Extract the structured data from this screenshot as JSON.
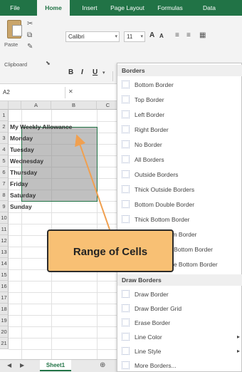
{
  "ribbon": {
    "tabs": [
      {
        "label": "File",
        "active": false
      },
      {
        "label": "Home",
        "active": true
      },
      {
        "label": "Insert",
        "active": false
      },
      {
        "label": "Page Layout",
        "active": false
      },
      {
        "label": "Formulas",
        "active": false
      },
      {
        "label": "Data",
        "active": false
      }
    ],
    "paste_label": "Paste",
    "clipboard_label": "Clipboard",
    "font_name": "Calibri",
    "font_size": "11",
    "grow_font": "A",
    "shrink_font": "A",
    "bold": "B",
    "italic": "I",
    "underline": "U"
  },
  "formula_bar": {
    "name_box": "A2"
  },
  "sheet": {
    "columns": [
      "A",
      "B",
      "C"
    ],
    "rows": [
      "1",
      "2",
      "3",
      "4",
      "5",
      "6",
      "7",
      "8",
      "9",
      "10",
      "11",
      "12",
      "13",
      "14",
      "15",
      "16",
      "17",
      "18",
      "19",
      "20",
      "21"
    ],
    "cells": [
      {
        "row": 2,
        "text": "My Weekly Allowance"
      },
      {
        "row": 3,
        "text": "Monday"
      },
      {
        "row": 4,
        "text": "Tuesday"
      },
      {
        "row": 5,
        "text": "Wednesday"
      },
      {
        "row": 6,
        "text": "Thursday"
      },
      {
        "row": 7,
        "text": "Friday"
      },
      {
        "row": 8,
        "text": "Saturday"
      },
      {
        "row": 9,
        "text": "Sunday"
      }
    ],
    "sheet_tab": "Sheet1"
  },
  "borders_menu": {
    "header": "Borders",
    "items": [
      "Bottom Border",
      "Top Border",
      "Left Border",
      "Right Border",
      "No Border",
      "All Borders",
      "Outside Borders",
      "Thick Outside Borders",
      "Bottom Double Border",
      "Thick Bottom Border",
      "Top and Bottom Border",
      "Top and Thick Bottom Border",
      "Top and Double Bottom Border"
    ],
    "draw_header": "Draw Borders",
    "draw_items": [
      "Draw Border",
      "Draw Border Grid",
      "Erase Border",
      "Line Color",
      "Line Style",
      "More Borders..."
    ]
  },
  "annotation": {
    "label": "Range of Cells"
  },
  "colors": {
    "excel_green": "#217346",
    "callout_fill": "#f8c074",
    "arrow": "#f0a050"
  }
}
